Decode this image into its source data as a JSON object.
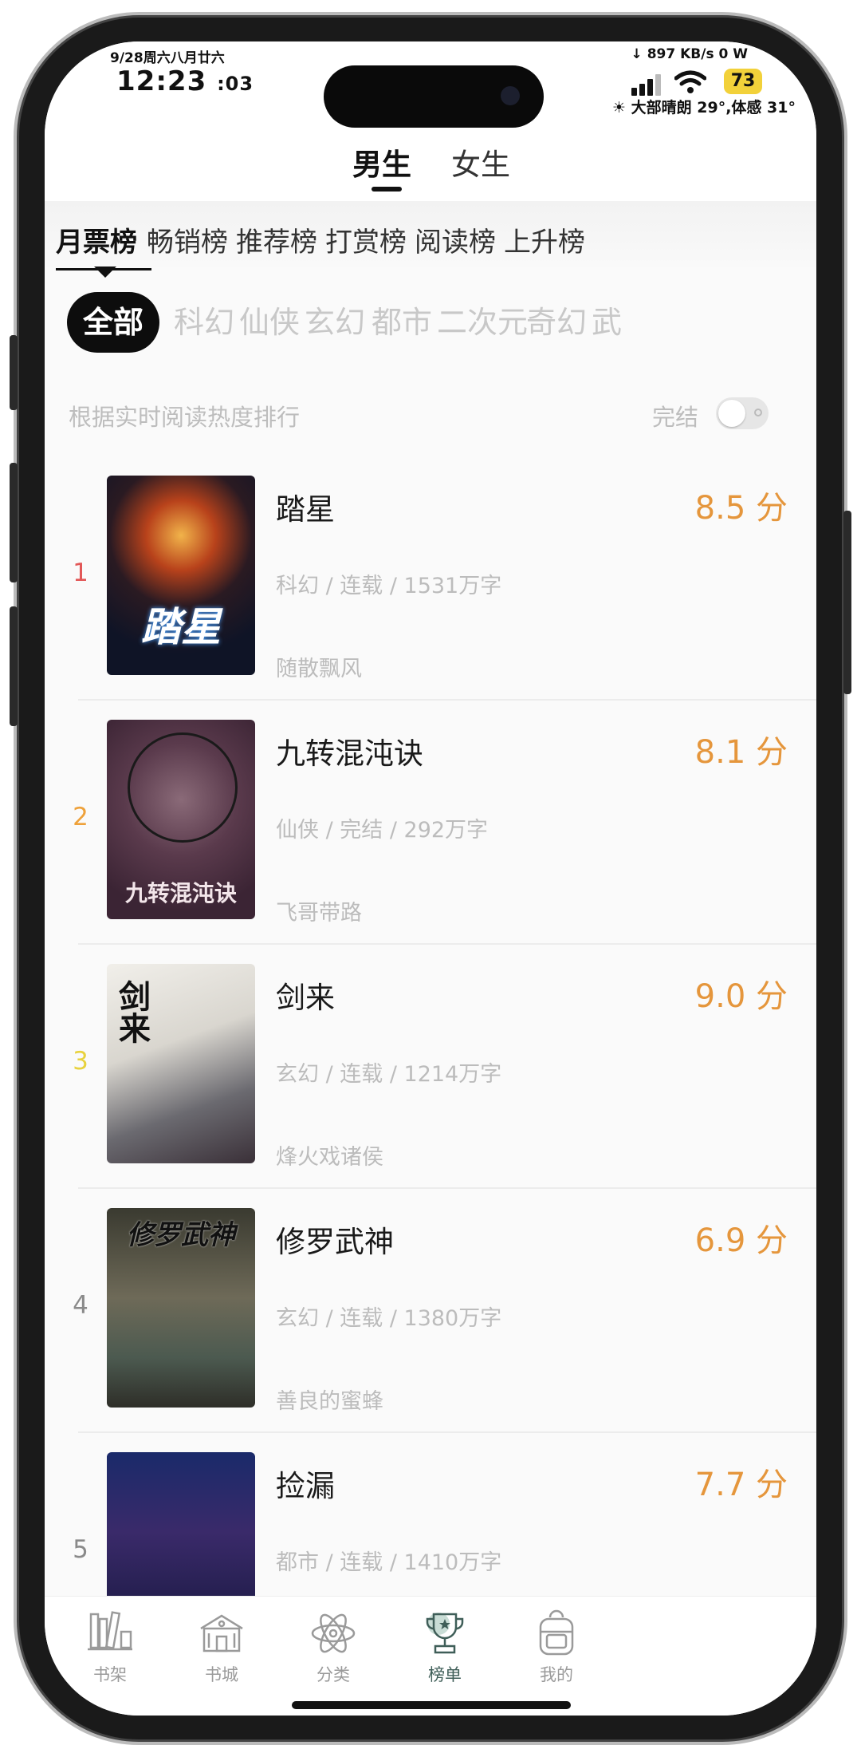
{
  "status": {
    "date": "9/28周六八月廿六",
    "time": "12:23",
    "seconds": ":03",
    "net_speed": "↓ 897 KB/s  0 W",
    "battery": "73",
    "weather": "☀ 大部晴朗 29°,体感 31°"
  },
  "gender_tabs": {
    "active": "男生",
    "inactive": "女生"
  },
  "rank_tabs": [
    "月票榜",
    "畅销榜",
    "推荐榜",
    "打赏榜",
    "阅读榜",
    "上升榜"
  ],
  "genres": [
    "全部",
    "科幻",
    "仙侠",
    "玄幻",
    "都市",
    "二次元",
    "奇幻",
    "武"
  ],
  "hint": "根据实时阅读热度排行",
  "completed_label": "完结",
  "completed_toggle_on": false,
  "books": [
    {
      "rank": "1",
      "title": "踏星",
      "meta": "科幻 / 连载 / 1531万字",
      "author": "随散飘风",
      "score": "8.5 分",
      "cover_title": "踏星",
      "rank_color": "#e25757"
    },
    {
      "rank": "2",
      "title": "九转混沌诀",
      "meta": "仙侠 / 完结 / 292万字",
      "author": "飞哥带路",
      "score": "8.1 分",
      "cover_title": "九转混沌诀",
      "rank_color": "#eea13a"
    },
    {
      "rank": "3",
      "title": "剑来",
      "meta": "玄幻 / 连载 / 1214万字",
      "author": "烽火戏诸侯",
      "score": "9.0 分",
      "cover_title": "剑来",
      "rank_color": "#e8d23e"
    },
    {
      "rank": "4",
      "title": "修罗武神",
      "meta": "玄幻 / 连载 / 1380万字",
      "author": "善良的蜜蜂",
      "score": "6.9 分",
      "cover_title": "修罗武神",
      "rank_color": "#8a8a8a"
    },
    {
      "rank": "5",
      "title": "捡漏",
      "meta": "都市 / 连载 / 1410万字",
      "author": "",
      "score": "7.7 分",
      "cover_title": "",
      "rank_color": "#8a8a8a"
    }
  ],
  "nav": [
    {
      "label": "书架",
      "icon": "bookshelf-icon"
    },
    {
      "label": "书城",
      "icon": "bookstore-icon"
    },
    {
      "label": "分类",
      "icon": "atom-icon"
    },
    {
      "label": "榜单",
      "icon": "trophy-icon",
      "active": true
    },
    {
      "label": "我的",
      "icon": "backpack-icon"
    }
  ],
  "colors": {
    "score": "#e5963c",
    "active_nav": "#3f5e58",
    "chip_active_bg": "#0d0d0d"
  }
}
